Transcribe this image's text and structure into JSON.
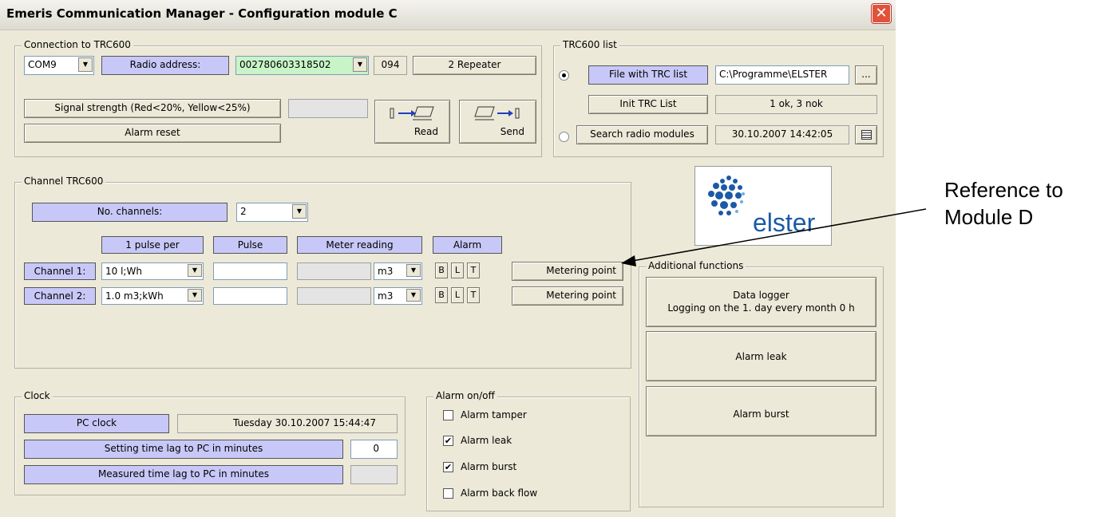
{
  "window": {
    "title": "Emeris Communication Manager - Configuration module C",
    "close": "✕"
  },
  "connection": {
    "legend": "Connection to TRC600",
    "com_port": "COM9",
    "radio_address_label": "Radio address:",
    "radio_address_value": "002780603318502",
    "address_suffix": "094",
    "repeater": "2 Repeater",
    "signal_strength": "Signal strength (Red<20%, Yellow<25%)",
    "alarm_reset": "Alarm reset",
    "read": "Read",
    "send": "Send"
  },
  "trc_list": {
    "legend": "TRC600 list",
    "file_btn": "File with TRC list",
    "file_path": "C:\\Programme\\ELSTER",
    "browse": "...",
    "init_btn": "Init TRC List",
    "init_status": "1 ok, 3 nok",
    "search_btn": "Search radio modules",
    "search_time": "30.10.2007 14:42:05",
    "selected_mode": "file"
  },
  "channels": {
    "legend": "Channel TRC600",
    "no_channels_label": "No. channels:",
    "no_channels_value": "2",
    "headers": {
      "pulse_per": "1 pulse per",
      "pulse": "Pulse",
      "meter_reading": "Meter reading",
      "alarm": "Alarm"
    },
    "rows": [
      {
        "label": "Channel 1:",
        "pulse_per": "10 l;Wh",
        "pulse": "",
        "meter_reading": "",
        "unit": "m3",
        "b": "B",
        "l": "L",
        "t": "T",
        "metering": "Metering point"
      },
      {
        "label": "Channel 2:",
        "pulse_per": "1.0 m3;kWh",
        "pulse": "",
        "meter_reading": "",
        "unit": "m3",
        "b": "B",
        "l": "L",
        "t": "T",
        "metering": "Metering point"
      }
    ]
  },
  "clock": {
    "legend": "Clock",
    "pc_clock": "PC clock",
    "pc_clock_value": "Tuesday  30.10.2007 15:44:47",
    "setting_lag": "Setting time lag to PC in minutes",
    "setting_lag_value": "0",
    "measured_lag": "Measured time lag to PC in minutes",
    "measured_lag_value": ""
  },
  "alarm_onoff": {
    "legend": "Alarm  on/off",
    "items": [
      {
        "label": "Alarm tamper",
        "checked": false
      },
      {
        "label": "Alarm leak",
        "checked": true
      },
      {
        "label": "Alarm burst",
        "checked": true
      },
      {
        "label": "Alarm back flow",
        "checked": false
      }
    ]
  },
  "logo": {
    "text": "elster",
    "brand_color": "#1b5aa6"
  },
  "additional": {
    "legend": "Additional functions",
    "data_logger_line1": "Data logger",
    "data_logger_line2": "Logging on the 1. day every month 0 h",
    "alarm_leak": "Alarm leak",
    "alarm_burst": "Alarm burst"
  },
  "annotation": {
    "line1": "Reference to",
    "line2": "Module D"
  }
}
